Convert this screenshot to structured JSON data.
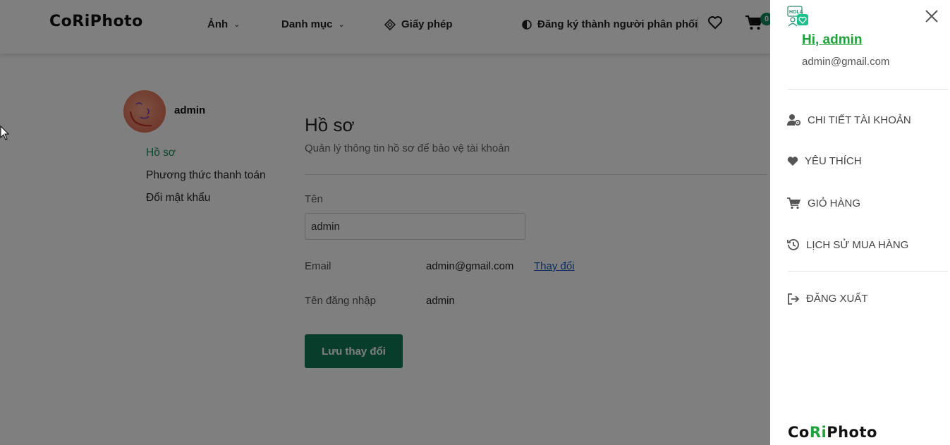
{
  "header": {
    "logo": "CoRiPhoto",
    "nav": {
      "photo": "Ảnh",
      "category": "Danh mục",
      "license": "Giấy phép",
      "distributor": "Đăng ký thành người phân phối"
    },
    "cart_count": "0"
  },
  "profile": {
    "username": "admin",
    "menu": {
      "profile": "Hồ sơ",
      "payment": "Phương thức thanh toán",
      "password": "Đổi mật khẩu"
    }
  },
  "content": {
    "title": "Hồ sơ",
    "subtitle": "Quản lý thông tin hồ sơ để bảo vệ tài khoản",
    "name_label": "Tên",
    "name_value": "admin",
    "email_label": "Email",
    "email_value": "admin@gmail.com",
    "change_link": "Thay đổi",
    "login_label": "Tên đăng nhập",
    "login_value": "admin",
    "save_button": "Lưu thay đổi"
  },
  "drawer": {
    "icon_text": "HOLA",
    "greeting": "Hi, admin",
    "email": "admin@gmail.com",
    "items": {
      "account": "CHI TIẾT TÀI KHOẢN",
      "favorites": "YÊU THÍCH",
      "cart": "GIỎ HÀNG",
      "history": "LỊCH SỬ MUA HÀNG",
      "logout": "ĐĂNG XUẤT"
    },
    "logo_parts": [
      "Co",
      "Ri",
      "Photo"
    ]
  },
  "colors": {
    "accent_green": "#1fa23a",
    "button_green": "#0f7a55",
    "link_blue": "#1a5bb8"
  }
}
